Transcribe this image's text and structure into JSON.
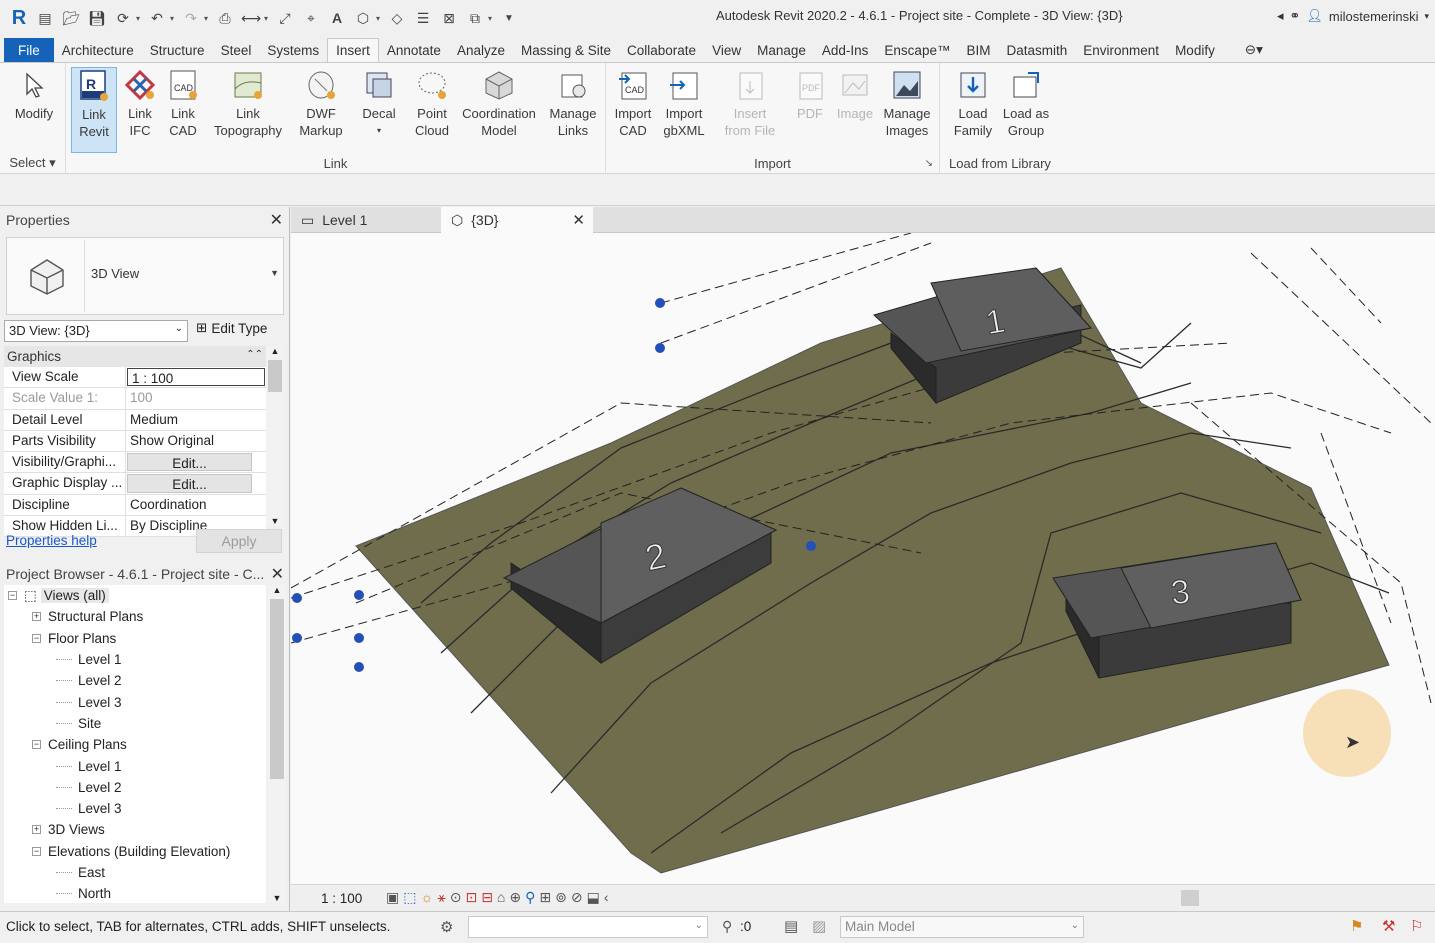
{
  "app": {
    "title": "Autodesk Revit 2020.2 - 4.6.1 - Project site - Complete - 3D View: {3D}",
    "user": "milostemerinski"
  },
  "ribbon_tabs": [
    "File",
    "Architecture",
    "Structure",
    "Steel",
    "Systems",
    "Insert",
    "Annotate",
    "Analyze",
    "Massing & Site",
    "Collaborate",
    "View",
    "Manage",
    "Add-Ins",
    "Enscape™",
    "BIM",
    "Datasmith",
    "Environment",
    "Modify"
  ],
  "ribbon": {
    "select": {
      "modify": "Modify",
      "title": "Select"
    },
    "link": {
      "title": "Link",
      "link_revit": [
        "Link",
        "Revit"
      ],
      "link_ifc": [
        "Link",
        "IFC"
      ],
      "link_cad": [
        "Link",
        "CAD"
      ],
      "link_topo": [
        "Link",
        "Topography"
      ],
      "dwf": [
        "DWF",
        "Markup"
      ],
      "decal": [
        "Decal",
        ""
      ],
      "point_cloud": [
        "Point",
        "Cloud"
      ],
      "coord_model": [
        "Coordination",
        "Model"
      ],
      "manage_links": [
        "Manage",
        "Links"
      ]
    },
    "import": {
      "title": "Import",
      "import_cad": [
        "Import",
        "CAD"
      ],
      "import_gbxml": [
        "Import",
        "gbXML"
      ],
      "insert_file": [
        "Insert",
        "from File"
      ],
      "pdf": "PDF",
      "image": "Image",
      "manage_images": [
        "Manage",
        "Images"
      ]
    },
    "library": {
      "title": "Load from Library",
      "load_family": [
        "Load",
        "Family"
      ],
      "load_group": [
        "Load as",
        "Group"
      ]
    }
  },
  "properties": {
    "title": "Properties",
    "type_name": "3D View",
    "view_selector": "3D View: {3D}",
    "edit_type": "Edit Type",
    "group": "Graphics",
    "rows": [
      {
        "name": "View Scale",
        "value": "1 : 100"
      },
      {
        "name": "Scale Value    1:",
        "value": "100"
      },
      {
        "name": "Detail Level",
        "value": "Medium"
      },
      {
        "name": "Parts Visibility",
        "value": "Show Original"
      },
      {
        "name": "Visibility/Graphi...",
        "value": "Edit..."
      },
      {
        "name": "Graphic Display ...",
        "value": "Edit..."
      },
      {
        "name": "Discipline",
        "value": "Coordination"
      },
      {
        "name": "Show Hidden Li...",
        "value": "By Discipline"
      }
    ],
    "help": "Properties help",
    "apply": "Apply"
  },
  "browser": {
    "title": "Project Browser - 4.6.1 - Project site - C...",
    "nodes": [
      {
        "label": "Views (all)",
        "level": 0,
        "box": "−"
      },
      {
        "label": "Structural Plans",
        "level": 1,
        "box": "+"
      },
      {
        "label": "Floor Plans",
        "level": 1,
        "box": "−"
      },
      {
        "label": "Level 1",
        "level": 2
      },
      {
        "label": "Level 2",
        "level": 2
      },
      {
        "label": "Level 3",
        "level": 2
      },
      {
        "label": "Site",
        "level": 2
      },
      {
        "label": "Ceiling Plans",
        "level": 1,
        "box": "−"
      },
      {
        "label": "Level 1",
        "level": 2
      },
      {
        "label": "Level 2",
        "level": 2
      },
      {
        "label": "Level 3",
        "level": 2
      },
      {
        "label": "3D Views",
        "level": 1,
        "box": "+"
      },
      {
        "label": "Elevations (Building Elevation)",
        "level": 1,
        "box": "−"
      },
      {
        "label": "East",
        "level": 2
      },
      {
        "label": "North",
        "level": 2
      }
    ]
  },
  "view_tabs": {
    "level1": "Level 1",
    "threed": "{3D}"
  },
  "canvas": {
    "building1": "1",
    "building2": "2",
    "building3": "3"
  },
  "viewbar": {
    "scale": "1 : 100"
  },
  "status": {
    "hint": "Click to select, TAB for alternates, CTRL adds, SHIFT unselects.",
    "count": ":0",
    "model": "Main Model"
  },
  "colors": {
    "accent": "#1463b8",
    "terrain": "#6e6c4a",
    "roof": "#5c5c5c"
  }
}
